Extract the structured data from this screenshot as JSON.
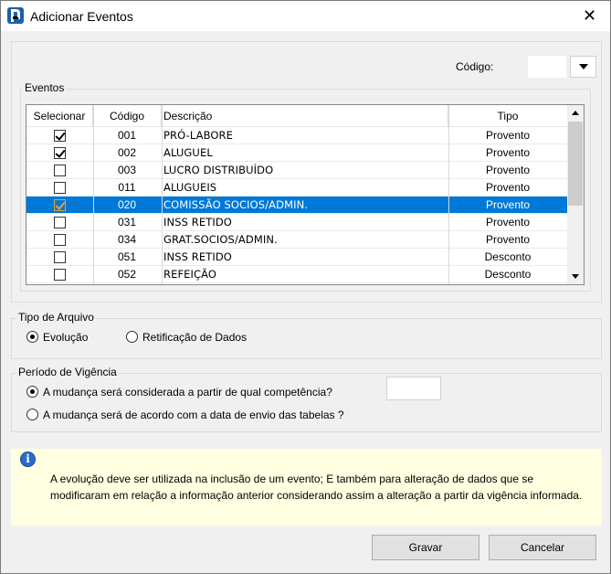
{
  "window": {
    "title": "Adicionar Eventos",
    "close_glyph": "✕"
  },
  "codigo": {
    "label": "Código:",
    "value": ""
  },
  "eventos": {
    "label": "Eventos",
    "columns": [
      "Selecionar",
      "Código",
      "Descrição",
      "Tipo"
    ],
    "rows": [
      {
        "checked": true,
        "codigo": "001",
        "descricao": "PRÓ-LABORE",
        "tipo": "Provento",
        "selected": false
      },
      {
        "checked": true,
        "codigo": "002",
        "descricao": "ALUGUEL",
        "tipo": "Provento",
        "selected": false
      },
      {
        "checked": false,
        "codigo": "003",
        "descricao": "LUCRO DISTRIBUÍDO",
        "tipo": "Provento",
        "selected": false
      },
      {
        "checked": false,
        "codigo": "011",
        "descricao": "ALUGUEIS",
        "tipo": "Provento",
        "selected": false
      },
      {
        "checked": true,
        "codigo": "020",
        "descricao": "COMISSÃO SOCIOS/ADMIN.",
        "tipo": "Provento",
        "selected": true
      },
      {
        "checked": false,
        "codigo": "031",
        "descricao": "INSS RETIDO",
        "tipo": "Provento",
        "selected": false
      },
      {
        "checked": false,
        "codigo": "034",
        "descricao": "GRAT.SOCIOS/ADMIN.",
        "tipo": "Provento",
        "selected": false
      },
      {
        "checked": false,
        "codigo": "051",
        "descricao": "INSS RETIDO",
        "tipo": "Desconto",
        "selected": false
      },
      {
        "checked": false,
        "codigo": "052",
        "descricao": "REFEIÇÃO",
        "tipo": "Desconto",
        "selected": false
      }
    ]
  },
  "tipo_arquivo": {
    "label": "Tipo de Arquivo",
    "options": [
      {
        "label": "Evolução",
        "selected": true
      },
      {
        "label": "Retificação de Dados",
        "selected": false
      }
    ]
  },
  "periodo": {
    "label": "Período de Vigência",
    "options": [
      {
        "label": "A mudança será considerada a partir de qual competência?",
        "selected": true
      },
      {
        "label": "A mudança será de acordo com a data de envio das tabelas ?",
        "selected": false
      }
    ],
    "competencia_value": ""
  },
  "info": {
    "icon": "info-icon",
    "text": "A evolução deve ser utilizada na inclusão de um evento; E também para alteração de dados que se modificaram em relação a informação anterior considerando assim a alteração a partir da vigência informada."
  },
  "buttons": {
    "save": "Gravar",
    "cancel": "Cancelar"
  }
}
